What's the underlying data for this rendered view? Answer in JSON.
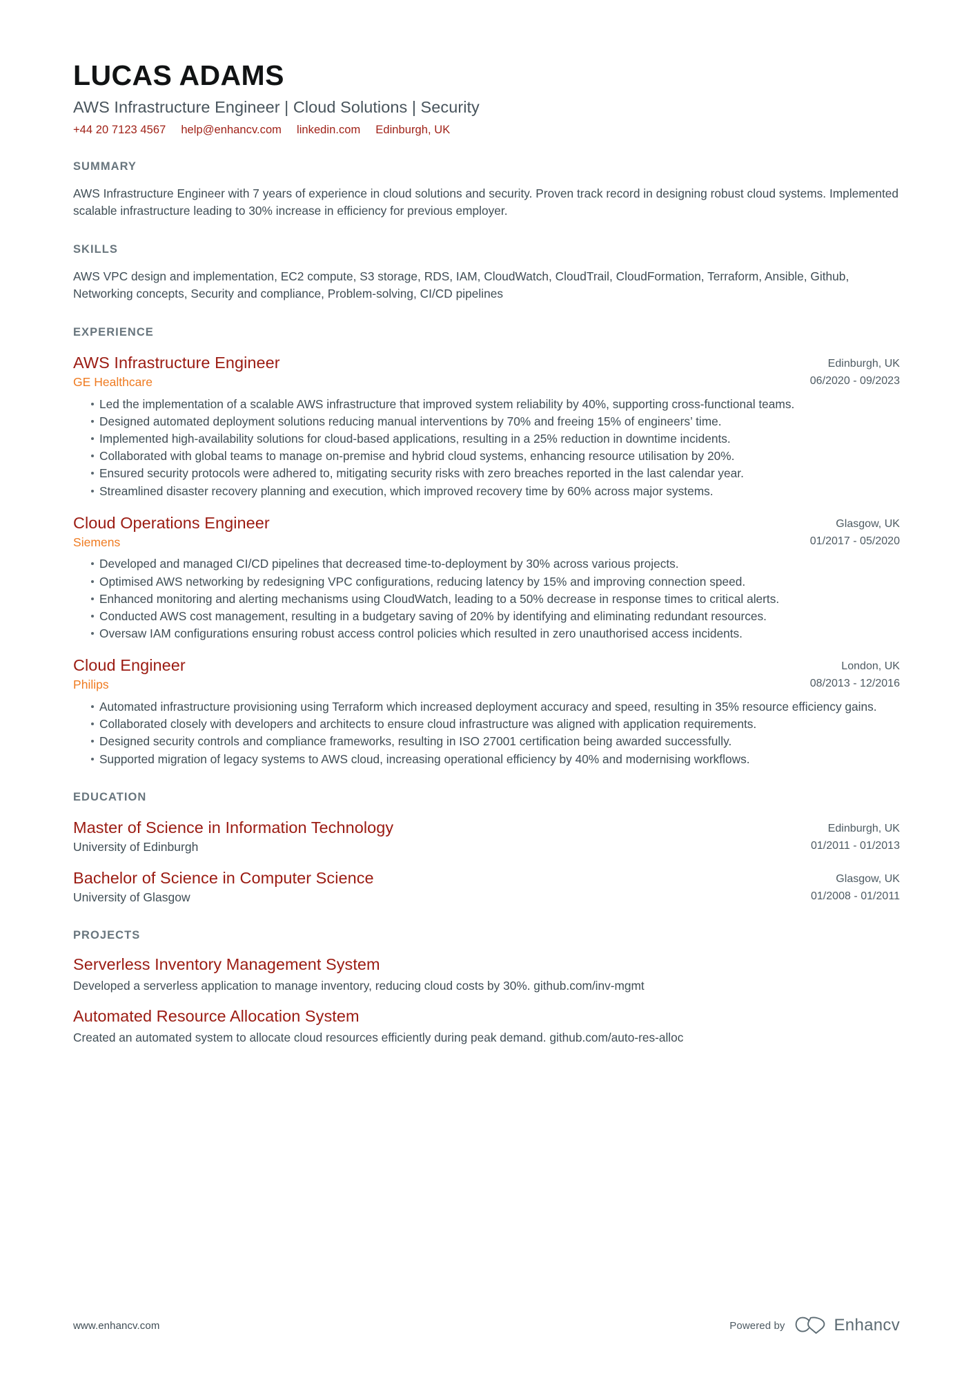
{
  "colors": {
    "accent_red": "#9b1b12",
    "accent_orange": "#ef7b21",
    "link_red": "#9f1f15",
    "heading_gray": "#68757d",
    "body_gray": "#3f4d55",
    "name_black": "#111314"
  },
  "header": {
    "name": "LUCAS ADAMS",
    "headline": "AWS Infrastructure Engineer | Cloud Solutions | Security",
    "contacts": [
      {
        "type": "phone",
        "value": "+44 20 7123 4567"
      },
      {
        "type": "email",
        "value": "help@enhancv.com"
      },
      {
        "type": "linkedin",
        "value": "linkedin.com"
      },
      {
        "type": "location",
        "value": "Edinburgh, UK"
      }
    ]
  },
  "summary": {
    "title": "SUMMARY",
    "text": "AWS Infrastructure Engineer with 7 years of experience in cloud solutions and security. Proven track record in designing robust cloud systems. Implemented scalable infrastructure leading to 30% increase in efficiency for previous employer."
  },
  "skills": {
    "title": "SKILLS",
    "text": "AWS VPC design and implementation, EC2 compute, S3 storage, RDS, IAM, CloudWatch, CloudTrail, CloudFormation, Terraform, Ansible, Github, Networking concepts, Security and compliance, Problem-solving, CI/CD pipelines"
  },
  "experience": {
    "title": "EXPERIENCE",
    "entries": [
      {
        "title": "AWS Infrastructure Engineer",
        "company": "GE Healthcare",
        "location": "Edinburgh, UK",
        "dates": "06/2020 - 09/2023",
        "bullets": [
          "Led the implementation of a scalable AWS infrastructure that improved system reliability by 40%, supporting cross-functional teams.",
          "Designed automated deployment solutions reducing manual interventions by 70% and freeing 15% of engineers’ time.",
          "Implemented high-availability solutions for cloud-based applications, resulting in a 25% reduction in downtime incidents.",
          "Collaborated with global teams to manage on-premise and hybrid cloud systems, enhancing resource utilisation by 20%.",
          "Ensured security protocols were adhered to, mitigating security risks with zero breaches reported in the last calendar year.",
          "Streamlined disaster recovery planning and execution, which improved recovery time by 60% across major systems."
        ]
      },
      {
        "title": "Cloud Operations Engineer",
        "company": "Siemens",
        "location": "Glasgow, UK",
        "dates": "01/2017 - 05/2020",
        "bullets": [
          "Developed and managed CI/CD pipelines that decreased time-to-deployment by 30% across various projects.",
          "Optimised AWS networking by redesigning VPC configurations, reducing latency by 15% and improving connection speed.",
          "Enhanced monitoring and alerting mechanisms using CloudWatch, leading to a 50% decrease in response times to critical alerts.",
          "Conducted AWS cost management, resulting in a budgetary saving of 20% by identifying and eliminating redundant resources.",
          "Oversaw IAM configurations ensuring robust access control policies which resulted in zero unauthorised access incidents."
        ]
      },
      {
        "title": "Cloud Engineer",
        "company": "Philips",
        "location": "London, UK",
        "dates": "08/2013 - 12/2016",
        "bullets": [
          "Automated infrastructure provisioning using Terraform which increased deployment accuracy and speed, resulting in 35% resource efficiency gains.",
          "Collaborated closely with developers and architects to ensure cloud infrastructure was aligned with application requirements.",
          "Designed security controls and compliance frameworks, resulting in ISO 27001 certification being awarded successfully.",
          "Supported migration of legacy systems to AWS cloud, increasing operational efficiency by 40% and modernising workflows."
        ]
      }
    ]
  },
  "education": {
    "title": "EDUCATION",
    "entries": [
      {
        "degree": "Master of Science in Information Technology",
        "school": "University of Edinburgh",
        "location": "Edinburgh, UK",
        "dates": "01/2011 - 01/2013"
      },
      {
        "degree": "Bachelor of Science in Computer Science",
        "school": "University of Glasgow",
        "location": "Glasgow, UK",
        "dates": "01/2008 - 01/2011"
      }
    ]
  },
  "projects": {
    "title": "PROJECTS",
    "entries": [
      {
        "name": "Serverless Inventory Management System",
        "description": "Developed a serverless application to manage inventory, reducing cloud costs by 30%. github.com/inv-mgmt"
      },
      {
        "name": "Automated Resource Allocation System",
        "description": "Created an automated system to allocate cloud resources efficiently during peak demand. github.com/auto-res-alloc"
      }
    ]
  },
  "footer": {
    "url": "www.enhancv.com",
    "powered_by": "Powered by",
    "brand": "Enhancv"
  }
}
